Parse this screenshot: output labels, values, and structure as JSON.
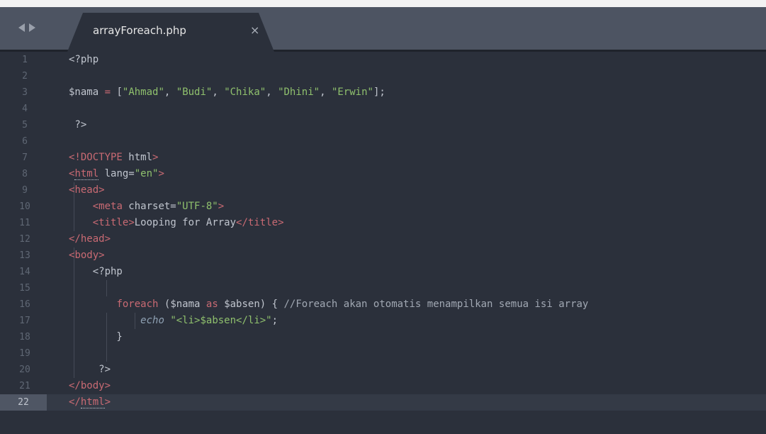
{
  "tab": {
    "filename": "arrayForeach.php",
    "close_glyph": "×"
  },
  "nav": {
    "back_icon": "chevron-left-icon",
    "forward_icon": "chevron-right-icon"
  },
  "editor": {
    "active_line": 22,
    "line_numbers": [
      "1",
      "2",
      "3",
      "4",
      "5",
      "6",
      "7",
      "8",
      "9",
      "10",
      "11",
      "12",
      "13",
      "14",
      "15",
      "16",
      "17",
      "18",
      "19",
      "20",
      "21",
      "22"
    ],
    "lines": [
      [
        {
          "t": "<?php",
          "c": "t-plain"
        }
      ],
      [],
      [
        {
          "t": "$nama",
          "c": "t-var"
        },
        {
          "t": " = ",
          "c": "t-kw"
        },
        {
          "t": "[",
          "c": "t-plain"
        },
        {
          "t": "\"Ahmad\"",
          "c": "t-str"
        },
        {
          "t": ", ",
          "c": "t-plain"
        },
        {
          "t": "\"Budi\"",
          "c": "t-str"
        },
        {
          "t": ", ",
          "c": "t-plain"
        },
        {
          "t": "\"Chika\"",
          "c": "t-str"
        },
        {
          "t": ", ",
          "c": "t-plain"
        },
        {
          "t": "\"Dhini\"",
          "c": "t-str"
        },
        {
          "t": ", ",
          "c": "t-plain"
        },
        {
          "t": "\"Erwin\"",
          "c": "t-str"
        },
        {
          "t": "];",
          "c": "t-plain"
        }
      ],
      [],
      [
        {
          "t": " ?>",
          "c": "t-plain"
        }
      ],
      [],
      [
        {
          "t": "<!",
          "c": "t-tagbr"
        },
        {
          "t": "DOCTYPE",
          "c": "t-tag"
        },
        {
          "t": " html",
          "c": "t-plain"
        },
        {
          "t": ">",
          "c": "t-tagbr"
        }
      ],
      [
        {
          "t": "<",
          "c": "t-tagbr"
        },
        {
          "t": "html",
          "c": "t-tag dotted"
        },
        {
          "t": " lang=",
          "c": "t-attr"
        },
        {
          "t": "\"en\"",
          "c": "t-str"
        },
        {
          "t": ">",
          "c": "t-tagbr"
        }
      ],
      [
        {
          "t": "<",
          "c": "t-tagbr"
        },
        {
          "t": "head",
          "c": "t-tag"
        },
        {
          "t": ">",
          "c": "t-tagbr"
        }
      ],
      [
        {
          "t": "    ",
          "c": "t-plain"
        },
        {
          "t": "<",
          "c": "t-tagbr"
        },
        {
          "t": "meta",
          "c": "t-tag"
        },
        {
          "t": " charset=",
          "c": "t-attr"
        },
        {
          "t": "\"UTF-8\"",
          "c": "t-str"
        },
        {
          "t": ">",
          "c": "t-tagbr"
        }
      ],
      [
        {
          "t": "    ",
          "c": "t-plain"
        },
        {
          "t": "<",
          "c": "t-tagbr"
        },
        {
          "t": "title",
          "c": "t-tag"
        },
        {
          "t": ">",
          "c": "t-tagbr"
        },
        {
          "t": "Looping for Array",
          "c": "t-plain"
        },
        {
          "t": "</",
          "c": "t-tagbr"
        },
        {
          "t": "title",
          "c": "t-tag"
        },
        {
          "t": ">",
          "c": "t-tagbr"
        }
      ],
      [
        {
          "t": "</",
          "c": "t-tagbr"
        },
        {
          "t": "head",
          "c": "t-tag"
        },
        {
          "t": ">",
          "c": "t-tagbr"
        }
      ],
      [
        {
          "t": "<",
          "c": "t-tagbr"
        },
        {
          "t": "body",
          "c": "t-tag"
        },
        {
          "t": ">",
          "c": "t-tagbr"
        }
      ],
      [
        {
          "t": "    <?php",
          "c": "t-plain"
        }
      ],
      [],
      [
        {
          "t": "        ",
          "c": "t-plain"
        },
        {
          "t": "foreach",
          "c": "t-kw"
        },
        {
          "t": " (",
          "c": "t-plain"
        },
        {
          "t": "$nama",
          "c": "t-var"
        },
        {
          "t": " as ",
          "c": "t-kw"
        },
        {
          "t": "$absen",
          "c": "t-var"
        },
        {
          "t": ") { ",
          "c": "t-plain"
        },
        {
          "t": "//Foreach akan otomatis menampilkan semua isi array",
          "c": "t-cmt"
        }
      ],
      [
        {
          "t": "            ",
          "c": "t-plain"
        },
        {
          "t": "echo",
          "c": "t-echo"
        },
        {
          "t": " ",
          "c": "t-plain"
        },
        {
          "t": "\"<li>$absen</li>\"",
          "c": "t-str"
        },
        {
          "t": ";",
          "c": "t-plain"
        }
      ],
      [
        {
          "t": "        }",
          "c": "t-plain"
        }
      ],
      [],
      [
        {
          "t": "     ?>",
          "c": "t-plain"
        }
      ],
      [
        {
          "t": "</",
          "c": "t-tagbr"
        },
        {
          "t": "body",
          "c": "t-tag"
        },
        {
          "t": ">",
          "c": "t-tagbr"
        }
      ],
      [
        {
          "t": "</",
          "c": "t-tagbr"
        },
        {
          "t": "html",
          "c": "t-tag dotted"
        },
        {
          "t": ">",
          "c": "t-tagbr"
        }
      ]
    ]
  },
  "colors": {
    "background": "#2b303b",
    "tabbar": "#4d5462",
    "string": "#8fc06d",
    "tag": "#c96a73"
  }
}
